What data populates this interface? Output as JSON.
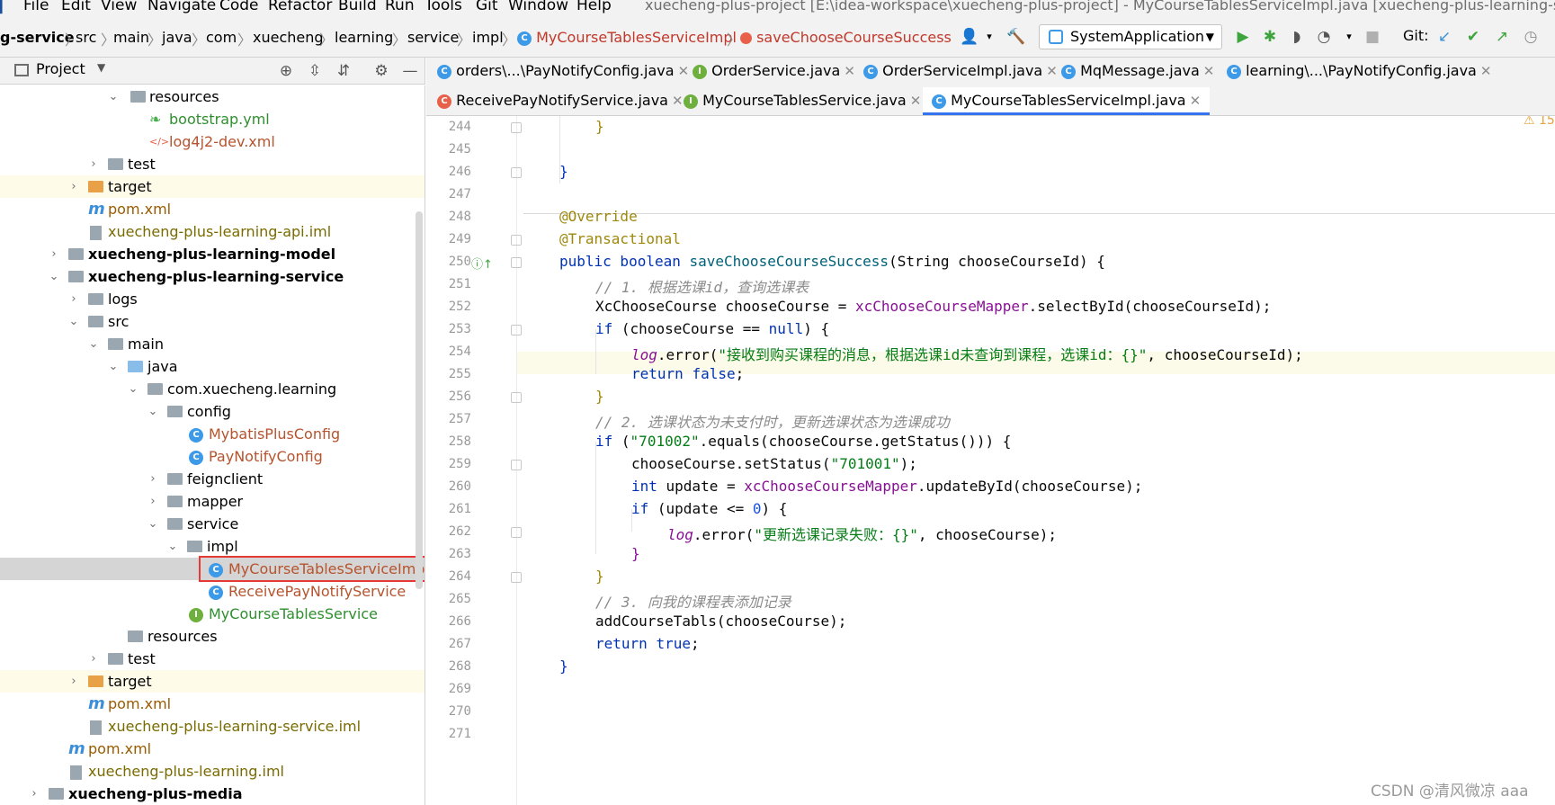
{
  "menu": [
    "File",
    "Edit",
    "View",
    "Navigate",
    "Code",
    "Refactor",
    "Build",
    "Run",
    "Tools",
    "Git",
    "Window",
    "Help"
  ],
  "window_title": "xuecheng-plus-project [E:\\idea-workspace\\xuecheng-plus-project] - MyCourseTablesServiceImpl.java [xuecheng-plus-learning-service]",
  "breadcrumb": [
    "g-service",
    "src",
    "main",
    "java",
    "com",
    "xuecheng",
    "learning",
    "service",
    "impl",
    "MyCourseTablesServiceImpl",
    "saveChooseCourseSuccess"
  ],
  "run_config": "SystemApplication",
  "git_label": "Git:",
  "sidebar": {
    "title": "Project"
  },
  "tree": [
    {
      "label": "resources",
      "type": "folder"
    },
    {
      "label": "bootstrap.yml",
      "type": "yml"
    },
    {
      "label": "log4j2-dev.xml",
      "type": "xml"
    },
    {
      "label": "test",
      "type": "folder"
    },
    {
      "label": "target",
      "type": "folder-orange"
    },
    {
      "label": "pom.xml",
      "type": "maven"
    },
    {
      "label": "xuecheng-plus-learning-api.iml",
      "type": "iml"
    },
    {
      "label": "xuecheng-plus-learning-model",
      "type": "module"
    },
    {
      "label": "xuecheng-plus-learning-service",
      "type": "module"
    },
    {
      "label": "logs",
      "type": "folder"
    },
    {
      "label": "src",
      "type": "folder"
    },
    {
      "label": "main",
      "type": "folder"
    },
    {
      "label": "java",
      "type": "folder-blue"
    },
    {
      "label": "com.xuecheng.learning",
      "type": "package"
    },
    {
      "label": "config",
      "type": "package"
    },
    {
      "label": "MybatisPlusConfig",
      "type": "class"
    },
    {
      "label": "PayNotifyConfig",
      "type": "class"
    },
    {
      "label": "feignclient",
      "type": "package"
    },
    {
      "label": "mapper",
      "type": "package"
    },
    {
      "label": "service",
      "type": "package"
    },
    {
      "label": "impl",
      "type": "package"
    },
    {
      "label": "MyCourseTablesServiceImp",
      "type": "class"
    },
    {
      "label": "ReceivePayNotifyService",
      "type": "class"
    },
    {
      "label": "MyCourseTablesService",
      "type": "interface"
    },
    {
      "label": "resources",
      "type": "folder"
    },
    {
      "label": "test",
      "type": "folder"
    },
    {
      "label": "target",
      "type": "folder-orange"
    },
    {
      "label": "pom.xml",
      "type": "maven"
    },
    {
      "label": "xuecheng-plus-learning-service.iml",
      "type": "iml"
    },
    {
      "label": "pom.xml",
      "type": "maven"
    },
    {
      "label": "xuecheng-plus-learning.iml",
      "type": "iml"
    },
    {
      "label": "xuecheng-plus-media",
      "type": "module"
    }
  ],
  "tabs_row1": [
    {
      "label": "orders\\...\\PayNotifyConfig.java",
      "icon": "class"
    },
    {
      "label": "OrderService.java",
      "icon": "interface"
    },
    {
      "label": "OrderServiceImpl.java",
      "icon": "class"
    },
    {
      "label": "MqMessage.java",
      "icon": "class"
    },
    {
      "label": "learning\\...\\PayNotifyConfig.java",
      "icon": "class"
    }
  ],
  "tabs_row2": [
    {
      "label": "ReceivePayNotifyService.java",
      "icon": "class-red"
    },
    {
      "label": "MyCourseTablesService.java",
      "icon": "interface"
    },
    {
      "label": "MyCourseTablesServiceImpl.java",
      "icon": "class"
    }
  ],
  "line_numbers": [
    "244",
    "245",
    "246",
    "247",
    "248",
    "249",
    "250",
    "251",
    "252",
    "253",
    "254",
    "255",
    "256",
    "257",
    "258",
    "259",
    "260",
    "261",
    "262",
    "263",
    "264",
    "265",
    "266",
    "267",
    "268",
    "269",
    "270",
    "271"
  ],
  "code": {
    "l244": "}",
    "l246": "}",
    "l248": "@Override",
    "l249": "@Transactional",
    "l250a": "public boolean ",
    "l250b": "saveChooseCourseSuccess",
    "l250c": "(String chooseCourseId) {",
    "l251": "// 1. 根据选课id，查询选课表",
    "l252a": "XcChooseCourse chooseCourse = ",
    "l252b": "xcChooseCourseMapper",
    ".": "",
    "l252c": ".selectById(chooseCourseId);",
    "l253a": "if ",
    "l253b": "(chooseCourse == ",
    "l253c": "null",
    ") {": "",
    "l253d": ") {",
    "l254a": "log",
    "l254b": ".error(",
    "l254c": "\"接收到购买课程的消息，根据选课id未查询到课程，选课id：{}\"",
    "l254d": ", chooseCourseId);",
    "l255a": "return ",
    "l255b": "false",
    ";": "",
    "l255c": ";",
    "l256": "}",
    "l257": "// 2. 选课状态为未支付时，更新选课状态为选课成功",
    "l258a": "if ",
    "l258b": "(",
    "l258c": "\"701002\"",
    "l258d": ".equals(chooseCourse.getStatus())) {",
    "l259a": "chooseCourse.setStatus(",
    "l259b": "\"701001\"",
    "l259c": ");",
    "l260a": "int ",
    "l260b": "update = ",
    "l260c": "xcChooseCourseMapper",
    "l260d": ".updateById(chooseCourse);",
    "l261a": "if ",
    "l261b": "(update <= ",
    "l261c": "0",
    "l261d": ") {",
    "l262a": "log",
    "l262b": ".error(",
    "l262c": "\"更新选课记录失败：{}\"",
    "l262d": ", chooseCourse);",
    "l263": "}",
    "l264": "}",
    "l265": "// 3. 向我的课程表添加记录",
    "l266": "addCourseTabls(chooseCourse);",
    "l267a": "return ",
    "l267b": "true",
    "l267c": ";",
    "l268": "}"
  },
  "warning_count": "15",
  "watermark": "CSDN @清风微凉 aaa",
  "colors": {
    "highlight_border": "#e53935",
    "selected_row": "#d5d5d5",
    "target_bg": "#fefce8"
  }
}
